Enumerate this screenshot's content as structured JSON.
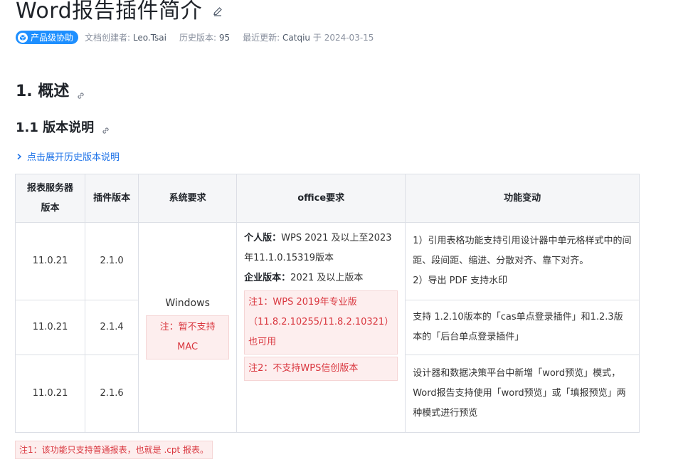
{
  "page": {
    "title": "Word报告插件简介",
    "badge": "产品级协助",
    "meta": {
      "creator_label": "文档创建者:",
      "creator": "Leo.Tsai",
      "history_label": "历史版本:",
      "history": "95",
      "updated_label": "最近更新:",
      "updater": "Catqiu",
      "updated_sep": "于",
      "updated_date": "2024-03-15"
    }
  },
  "sections": {
    "h1": "1. 概述",
    "h2": "1.1 版本说明",
    "expand_label": "点击展开历史版本说明"
  },
  "table": {
    "headers": [
      "报表服务器版本",
      "插件版本",
      "系统要求",
      "office要求",
      "功能变动"
    ],
    "rows": [
      {
        "server": "11.0.21",
        "plugin": "2.1.0",
        "changes": [
          "1）引用表格功能支持引用设计器中单元格样式中的间距、段间距、缩进、分散对齐、靠下对齐。",
          "2）导出 PDF 支持水印"
        ]
      },
      {
        "server": "11.0.21",
        "plugin": "2.1.4",
        "changes": [
          "支持 1.2.10版本的「cas单点登录插件」和1.2.3版本的「后台单点登录插件」"
        ]
      },
      {
        "server": "11.0.21",
        "plugin": "2.1.6",
        "changes": [
          "设计器和数据决策平台中新增「word预览」模式，Word报告支持使用「word预览」或「填报预览」两种模式进行预览"
        ]
      }
    ],
    "system": {
      "os": "Windows",
      "note": "注：暂不支持MAC"
    },
    "office": {
      "personal_label": "个人版：",
      "personal_value": "WPS 2021 及以上至2023年11.1.0.15319版本",
      "enterprise_label": "企业版本：",
      "enterprise_value": "2021 及以上版本",
      "note1": "注1：WPS 2019年专业版（11.8.2.10255/11.8.2.10321）也可用",
      "note2": "注2：不支持WPS信创版本"
    }
  },
  "footnote": "注1：该功能只支持普通报表，也就是 .cpt 报表。"
}
